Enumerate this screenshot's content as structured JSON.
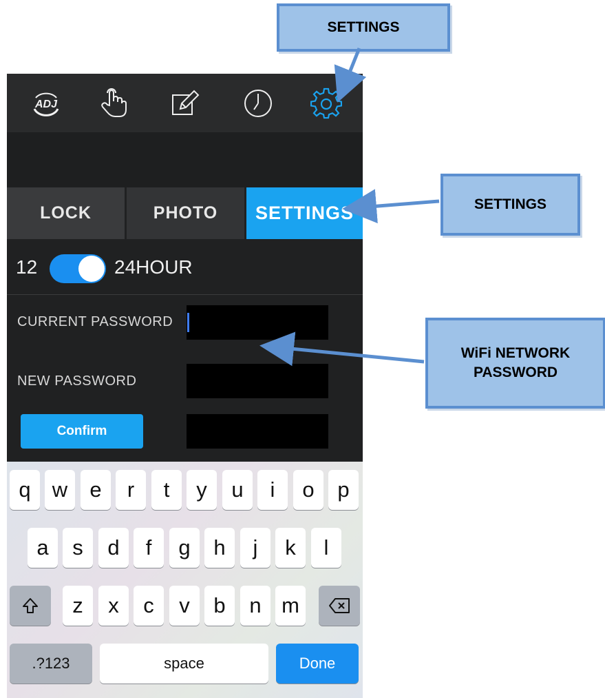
{
  "toolbar": {
    "icons": [
      "adj-logo-icon",
      "touch-hand-icon",
      "edit-pencil-icon",
      "clock-icon",
      "gear-icon"
    ],
    "logo_text": "ADJ"
  },
  "tabs": {
    "lock": "LOCK",
    "photo": "PHOTO",
    "settings": "SETTINGS",
    "active": "SETTINGS"
  },
  "clock_toggle": {
    "left_label": "12",
    "right_label": "24HOUR",
    "selected": "24HOUR"
  },
  "fields": {
    "current_password_label": "CURRENT PASSWORD",
    "current_password_value": "",
    "new_password_label": "NEW PASSWORD",
    "new_password_value": "",
    "confirm_button": "Confirm",
    "confirm_value": ""
  },
  "keyboard": {
    "row1": [
      "q",
      "w",
      "e",
      "r",
      "t",
      "y",
      "u",
      "i",
      "o",
      "p"
    ],
    "row2": [
      "a",
      "s",
      "d",
      "f",
      "g",
      "h",
      "j",
      "k",
      "l"
    ],
    "row3": [
      "z",
      "x",
      "c",
      "v",
      "b",
      "n",
      "m"
    ],
    "shift_icon": "shift-icon",
    "backspace_icon": "backspace-icon",
    "numbers_key": ".?123",
    "space_key": "space",
    "done_key": "Done"
  },
  "callouts": {
    "top": "SETTINGS",
    "right": "SETTINGS",
    "wifi_line1": "WiFi NETWORK",
    "wifi_line2": "PASSWORD"
  },
  "colors": {
    "accent": "#1aa3f0",
    "callout_fill": "#9ec2e8",
    "callout_border": "#5b8fd0",
    "app_background": "#202122"
  }
}
